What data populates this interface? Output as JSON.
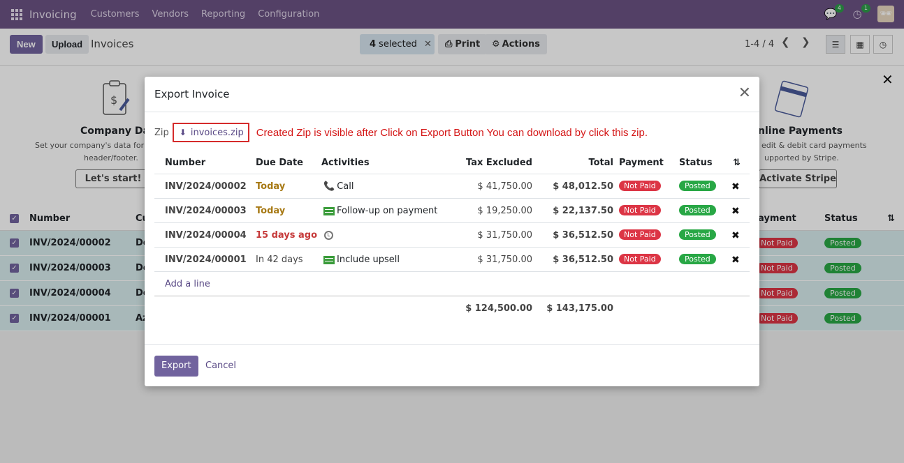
{
  "navbar": {
    "brand": "Invoicing",
    "menu": [
      "Customers",
      "Vendors",
      "Reporting",
      "Configuration"
    ],
    "messages_count": "4",
    "activities_count": "1"
  },
  "control_panel": {
    "new_label": "New",
    "upload_label": "Upload",
    "title": "Invoices",
    "selected_count": "4",
    "selected_label": "selected",
    "print_label": "Print",
    "actions_label": "Actions",
    "pager": "1-4 / 4"
  },
  "background": {
    "cards": [
      {
        "title": "Company Data",
        "text_line1": "Set your company's data for",
        "text_line2": "header/footer.",
        "button": "Let's start!"
      },
      {
        "title": "nline Payments",
        "text_line1": "edit & debit card payments",
        "text_line2": "upported by Stripe.",
        "button": "Activate Stripe"
      }
    ],
    "table_headers": {
      "number": "Number",
      "customer": "Cu",
      "payment": "ayment",
      "status": "Status"
    },
    "rows": [
      {
        "number": "INV/2024/00002",
        "customer": "De",
        "payment": "Not Paid",
        "status": "Posted"
      },
      {
        "number": "INV/2024/00003",
        "customer": "De",
        "payment": "Not Paid",
        "status": "Posted"
      },
      {
        "number": "INV/2024/00004",
        "customer": "De",
        "payment": "Not Paid",
        "status": "Posted"
      },
      {
        "number": "INV/2024/00001",
        "customer": "Az",
        "payment": "Not Paid",
        "status": "Posted"
      }
    ]
  },
  "modal": {
    "title": "Export Invoice",
    "zip_label": "Zip",
    "zip_file": "invoices.zip",
    "zip_note": "Created Zip is visible after Click on Export Button You can download by click this zip.",
    "headers": {
      "number": "Number",
      "due_date": "Due Date",
      "activities": "Activities",
      "tax_excluded": "Tax Excluded",
      "total": "Total",
      "payment": "Payment",
      "status": "Status"
    },
    "rows": [
      {
        "number": "INV/2024/00002",
        "due": "Today",
        "due_state": "today",
        "activity_icon": "phone-icon",
        "activity": "Call",
        "tax_excluded": "$ 41,750.00",
        "total": "$ 48,012.50",
        "payment": "Not Paid",
        "status": "Posted"
      },
      {
        "number": "INV/2024/00003",
        "due": "Today",
        "due_state": "today",
        "activity_icon": "todo-icon",
        "activity": "Follow-up on payment",
        "tax_excluded": "$ 19,250.00",
        "total": "$ 22,137.50",
        "payment": "Not Paid",
        "status": "Posted"
      },
      {
        "number": "INV/2024/00004",
        "due": "15 days ago",
        "due_state": "overdue",
        "activity_icon": "clock-icon",
        "activity": "",
        "tax_excluded": "$ 31,750.00",
        "total": "$ 36,512.50",
        "payment": "Not Paid",
        "status": "Posted"
      },
      {
        "number": "INV/2024/00001",
        "due": "In 42 days",
        "due_state": "future",
        "activity_icon": "todo-icon",
        "activity": "Include upsell",
        "tax_excluded": "$ 31,750.00",
        "total": "$ 36,512.50",
        "payment": "Not Paid",
        "status": "Posted"
      }
    ],
    "add_line": "Add a line",
    "total_tax_excluded": "$ 124,500.00",
    "total_total": "$ 143,175.00",
    "export_label": "Export",
    "cancel_label": "Cancel"
  },
  "colors": {
    "navbar": "#6b5283",
    "primary": "#71639e",
    "danger": "#dc3545",
    "success": "#28a745",
    "note": "#d41616"
  }
}
